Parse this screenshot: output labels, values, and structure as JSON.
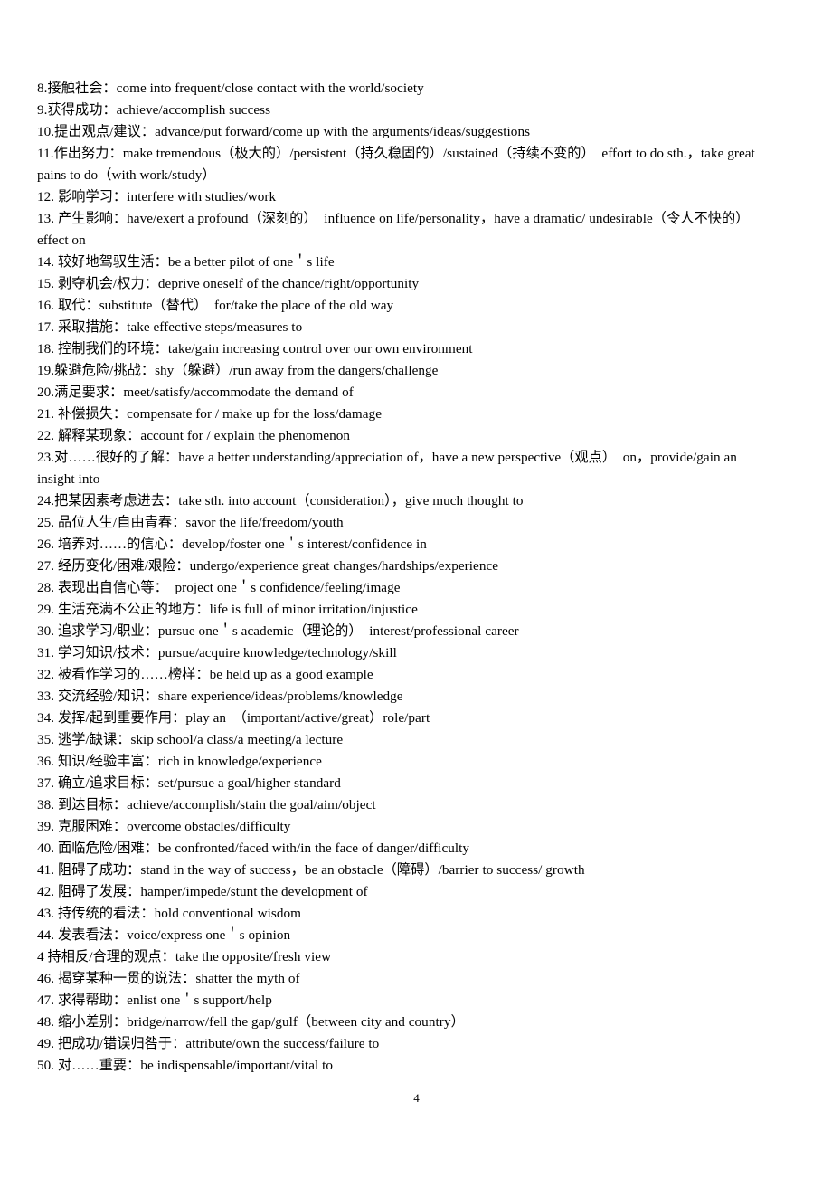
{
  "document": {
    "page_number": "4",
    "lines": [
      "8.接触社会：come into frequent/close contact with the world/society",
      "9.获得成功：achieve/accomplish success",
      "10.提出观点/建议：advance/put forward/come up with the arguments/ideas/suggestions",
      "11.作出努力：make tremendous（极大的）/persistent（持久稳固的）/sustained（持续不变的）　effort to do sth.，take great",
      "pains to do（with work/study）",
      "12. 影响学习：interfere with studies/work",
      "13. 产生影响：have/exert a profound（深刻的）　influence on life/personality，have a dramatic/ undesirable（令人不快的）",
      "effect on",
      "14. 较好地驾驭生活：be a better pilot of one＇s life",
      "15. 剥夺机会/权力：deprive oneself of the chance/right/opportunity",
      "16. 取代：substitute（替代）　for/take the place of the old way",
      "17. 采取措施：take effective steps/measures to",
      "18. 控制我们的环境：take/gain increasing control over our own environment",
      "19.躲避危险/挑战：shy（躲避）/run away from the dangers/challenge",
      "20.满足要求：meet/satisfy/accommodate the demand of",
      "21. 补偿损失：compensate for / make up for the loss/damage",
      "22. 解释某现象：account for / explain the phenomenon",
      "23.对……很好的了解：have a better understanding/appreciation of，have a new perspective（观点）　on，provide/gain an",
      "insight into",
      "24.把某因素考虑进去：take sth. into account（consideration），give much thought to",
      "25. 品位人生/自由青春：savor the life/freedom/youth",
      "26. 培养对……的信心：develop/foster one＇s interest/confidence in",
      "27. 经历变化/困难/艰险：undergo/experience great changes/hardships/experience",
      "28. 表现出自信心等：　project one＇s confidence/feeling/image",
      "29. 生活充满不公正的地方：life is full of minor irritation/injustice",
      "30. 追求学习/职业：pursue one＇s academic（理论的）　interest/professional career",
      "31. 学习知识/技术：pursue/acquire knowledge/technology/skill",
      "32. 被看作学习的……榜样：be held up as a good example",
      "33. 交流经验/知识：share experience/ideas/problems/knowledge",
      "34. 发挥/起到重要作用：play an　（important/active/great）role/part",
      "35. 逃学/缺课：skip school/a class/a meeting/a lecture",
      "36. 知识/经验丰富：rich in knowledge/experience",
      "37. 确立/追求目标：set/pursue a goal/higher standard",
      "38. 到达目标：achieve/accomplish/stain the goal/aim/object",
      "39. 克服困难：overcome obstacles/difficulty",
      "40. 面临危险/困难：be confronted/faced with/in the face of danger/difficulty",
      "41. 阻碍了成功：stand in the way of success，be an obstacle（障碍）/barrier to success/ growth",
      "42. 阻碍了发展：hamper/impede/stunt the development of",
      "43. 持传统的看法：hold conventional wisdom",
      "44. 发表看法：voice/express one＇s opinion",
      "4 持相反/合理的观点：take the opposite/fresh view",
      "46. 揭穿某种一贯的说法：shatter the myth of",
      "47. 求得帮助：enlist one＇s support/help",
      "48. 缩小差别：bridge/narrow/fell the gap/gulf（between city and country）",
      "49. 把成功/错误归咎于：attribute/own the success/failure to",
      "50. 对……重要：be indispensable/important/vital to"
    ]
  }
}
